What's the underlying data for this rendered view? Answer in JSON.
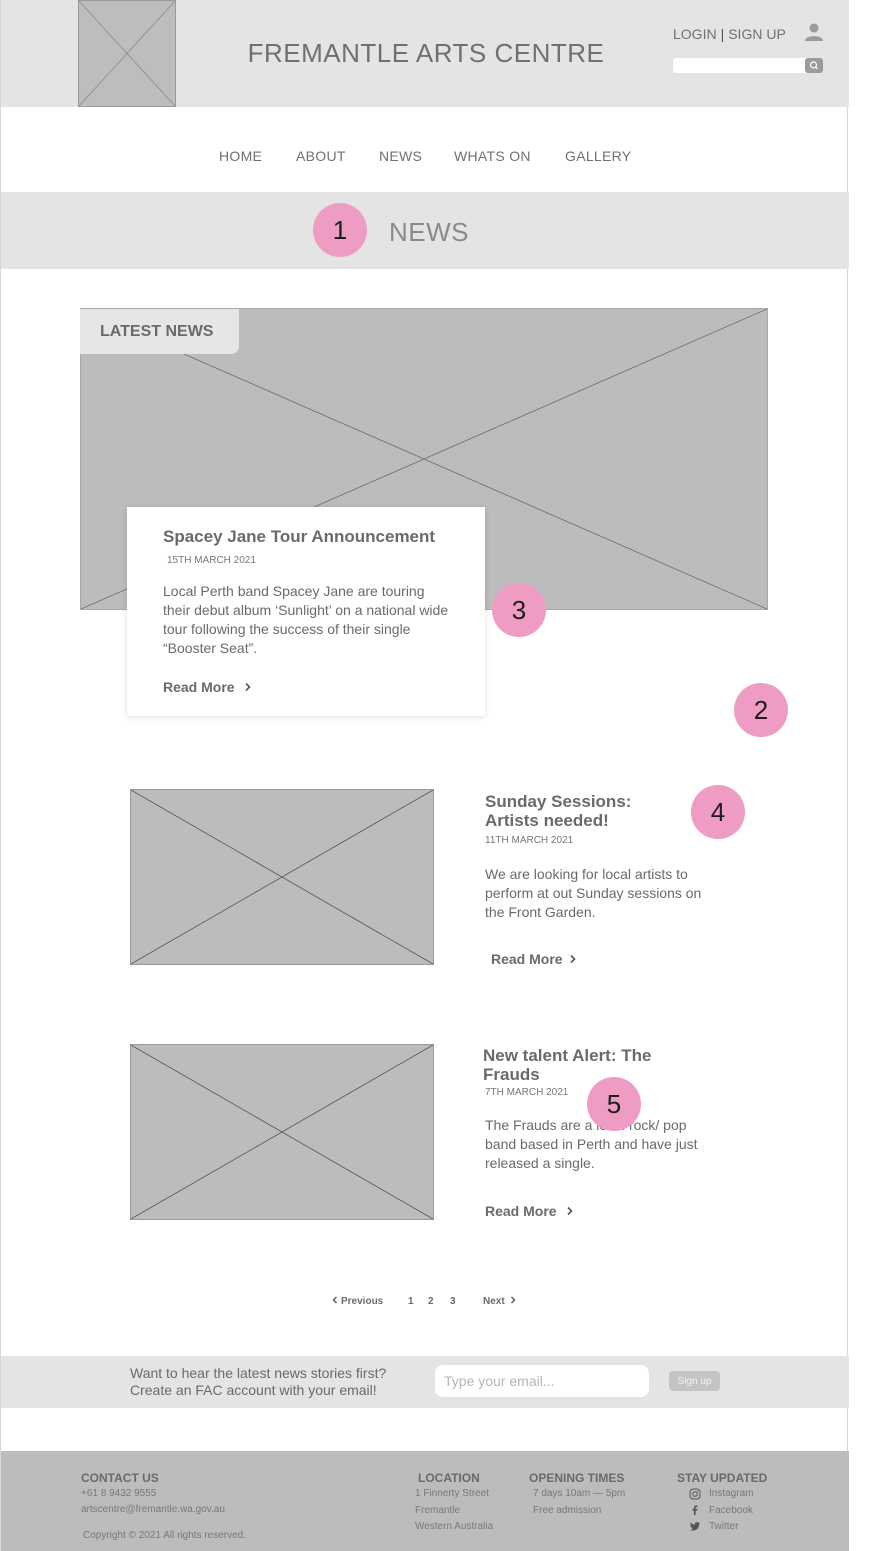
{
  "header": {
    "site_title": "FREMANTLE ARTS CENTRE",
    "login": "LOGIN",
    "separator": "|",
    "signup": "SIGN UP",
    "search_placeholder": ""
  },
  "nav": [
    {
      "label": "HOME"
    },
    {
      "label": "ABOUT"
    },
    {
      "label": "NEWS"
    },
    {
      "label": "WHATS ON"
    },
    {
      "label": "GALLERY"
    }
  ],
  "banner": {
    "title": "NEWS"
  },
  "markers": [
    "1",
    "2",
    "3",
    "4",
    "5"
  ],
  "featured": {
    "tag": "LATEST NEWS",
    "title": "Spacey Jane Tour Announcement",
    "date": "15TH MARCH 2021",
    "body": "Local Perth band Spacey Jane are touring their debut album ‘Sunlight’ on a national wide tour following the success of their single “Booster Seat”.",
    "read_more": "Read More"
  },
  "articles": [
    {
      "title": "Sunday Sessions: Artists needed!",
      "date": "11TH MARCH 2021",
      "body": "We are looking for local artists to perform at out Sunday sessions on the Front Garden.",
      "read_more": "Read More"
    },
    {
      "title": "New talent Alert: The Frauds",
      "date": "7TH MARCH 2021",
      "body": "The Frauds are a local rock/ pop band based in Perth and have just released a single.",
      "read_more": "Read More"
    }
  ],
  "pagination": {
    "previous": "Previous",
    "pages": [
      "1",
      "2",
      "3"
    ],
    "next": "Next"
  },
  "signup": {
    "line1": "Want to hear the latest news stories first?",
    "line2": "Create an FAC account with your email!",
    "email_placeholder": "Type your email...",
    "button": "Sign up"
  },
  "footer": {
    "contact": {
      "heading": "CONTACT US",
      "phone": "+61 8 9432 9555",
      "email": "artscentre@fremantle.wa.gov.au"
    },
    "copyright": "Copyright © 2021 All rights reserved.",
    "location": {
      "heading": "LOCATION",
      "lines": [
        "1 Finnerty Street",
        "Fremantle",
        "Western Australia"
      ]
    },
    "hours": {
      "heading": "OPENING TIMES",
      "lines": [
        "7 days 10am — 5pm",
        "Free admission"
      ]
    },
    "social": {
      "heading": "STAY UPDATED",
      "links": [
        "Instagram",
        "Facebook",
        "Twitter"
      ]
    }
  }
}
